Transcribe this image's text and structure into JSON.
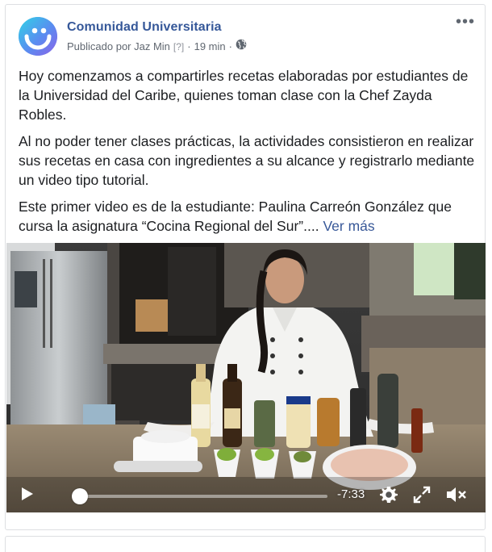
{
  "post": {
    "page_name": "Comunidad Universitaria",
    "published_by": "Publicado por Jaz Min",
    "unknown_marker": "[?]",
    "separator": "·",
    "time_ago": "19 min",
    "privacy_icon": "globe-icon",
    "more_icon": "more-options-icon",
    "more_label": "•••",
    "paragraphs": [
      "Hoy comenzamos a compartirles recetas elaboradas por estudiantes de la Universidad del Caribe, quienes toman clase con la Chef Zayda Robles.",
      "Al no poder tener clases prácticas, la actividades consistieron en realizar sus recetas en casa con ingredientes a su alcance y registrarlo mediante un video tipo tutorial.",
      "Este primer video es de la estudiante: Paulina Carreón González que cursa la asignatura “Cocina Regional del Sur”...."
    ],
    "see_more": "Ver más"
  },
  "video": {
    "time_remaining": "-7:33",
    "progress": 0.02,
    "controls": {
      "play": "play-icon",
      "settings": "gear-icon",
      "fullscreen": "fullscreen-icon",
      "volume": "volume-muted-icon"
    }
  },
  "colors": {
    "link": "#365899",
    "meta": "#606770",
    "text": "#1c1e21",
    "border": "#dddfe2"
  }
}
